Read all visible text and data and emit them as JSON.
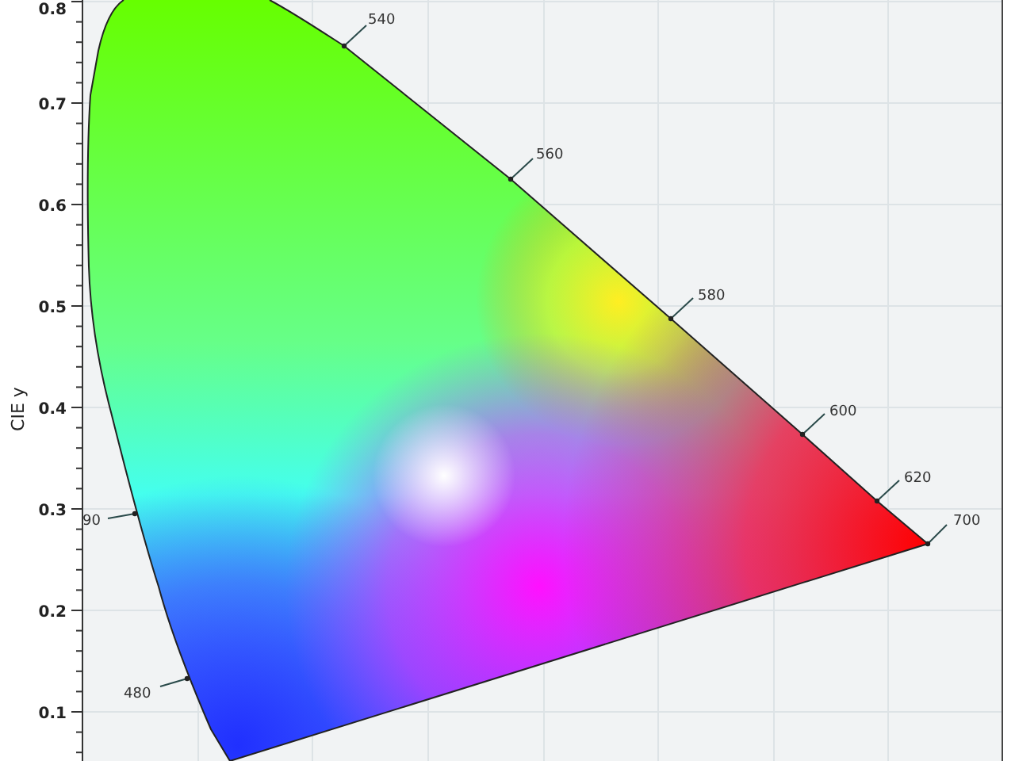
{
  "diagram": {
    "y_axis": {
      "title": "CIE y",
      "tick_labels": [
        "0.8",
        "0.7",
        "0.6",
        "0.5",
        "0.4",
        "0.3",
        "0.2",
        "0.1"
      ]
    },
    "wavelength_labels": [
      "540",
      "560",
      "580",
      "600",
      "620",
      "700",
      "90",
      "480"
    ]
  }
}
